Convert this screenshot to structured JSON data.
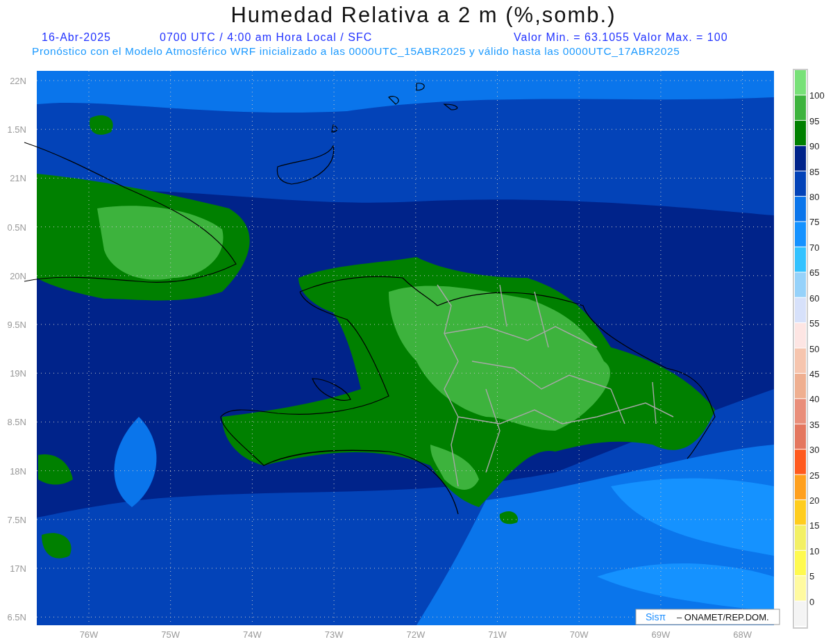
{
  "title": "Humedad Relativa a 2 m (%,somb.)",
  "info_line": {
    "date": "16-Abr-2025",
    "time": "0700 UTC / 4:00 am Hora Local / SFC",
    "range": "Valor Min. = 63.1055  Valor Max. = 100"
  },
  "model_line": "Pronóstico con el Modelo Atmosférico WRF inicializado a las 0000UTC_15ABR2025 y válido hasta las  0000UTC_17ABR2025",
  "map": {
    "lat_labels": [
      "22N",
      "1.5N",
      "21N",
      "0.5N",
      "20N",
      "9.5N",
      "19N",
      "8.5N",
      "18N",
      "7.5N",
      "17N",
      "6.5N"
    ],
    "lon_labels": [
      "76W",
      "75W",
      "74W",
      "73W",
      "72W",
      "71W",
      "70W",
      "69W",
      "68W"
    ]
  },
  "colorbar": [
    {
      "color": "#78e178",
      "label": "100"
    },
    {
      "color": "#3db33d",
      "label": "95"
    },
    {
      "color": "#008000",
      "label": "90"
    },
    {
      "color": "#00238a",
      "label": "85"
    },
    {
      "color": "#0343b8",
      "label": "80"
    },
    {
      "color": "#0a75eb",
      "label": "75"
    },
    {
      "color": "#1592ff",
      "label": "70"
    },
    {
      "color": "#33c2ff",
      "label": "65"
    },
    {
      "color": "#96d2fa",
      "label": "60"
    },
    {
      "color": "#d7e1fa",
      "label": "55"
    },
    {
      "color": "#fde5e3",
      "label": "50"
    },
    {
      "color": "#f6c5ae",
      "label": "45"
    },
    {
      "color": "#efaf90",
      "label": "40"
    },
    {
      "color": "#e98e7a",
      "label": "35"
    },
    {
      "color": "#e4775f",
      "label": "30"
    },
    {
      "color": "#ff5a1e",
      "label": "25"
    },
    {
      "color": "#ffa01e",
      "label": "20"
    },
    {
      "color": "#ffcd1e",
      "label": "15"
    },
    {
      "color": "#f3f065",
      "label": "10"
    },
    {
      "color": "#fffa50",
      "label": "5"
    },
    {
      "color": "#fffaa0",
      "label": "0"
    },
    {
      "color": "#f4f4f4"
    }
  ],
  "credit": {
    "brand": "Sisπ",
    "text": "– ONAMET/REP.DOM."
  }
}
